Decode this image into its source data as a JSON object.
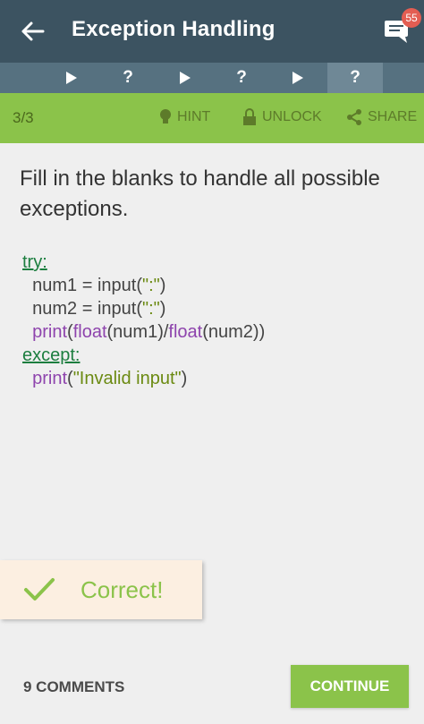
{
  "appbar": {
    "title": "Exception Handling",
    "notification_count": "55"
  },
  "tabs": [
    {
      "label": "",
      "icon": "play-icon"
    },
    {
      "label": "?",
      "icon": ""
    },
    {
      "label": "",
      "icon": "play-icon"
    },
    {
      "label": "?",
      "icon": ""
    },
    {
      "label": "",
      "icon": "play-icon"
    },
    {
      "label": "?",
      "icon": "",
      "active": true
    }
  ],
  "toolbar": {
    "progress": "3/3",
    "hint": "HINT",
    "unlock": "UNLOCK",
    "share": "SHARE"
  },
  "question": "Fill in the blanks to handle all possible exceptions.",
  "code": {
    "try": "try:",
    "line1_var": "num1 = input(",
    "line1_str": "\":\"",
    "line1_end": ")",
    "line2_var": "num2 = input(",
    "line2_str": "\":\"",
    "line2_end": ")",
    "line3_print": "print",
    "line3_open": "(",
    "line3_float1": "float",
    "line3_arg1": "(num1)/",
    "line3_float2": "float",
    "line3_arg2": "(num2))",
    "except": "except:",
    "line4_print": "print",
    "line4_open": "(",
    "line4_str": "\"Invalid input\"",
    "line4_end": ")"
  },
  "toast": {
    "text": "Correct!"
  },
  "footer": {
    "comments": "9 COMMENTS",
    "continue": "CONTINUE"
  },
  "colors": {
    "appbar": "#3c5361",
    "tabs": "#567180",
    "accent": "#8bc34a",
    "keyword": "#1c7e3f",
    "function": "#8e44ad",
    "string": "#6b8a12"
  }
}
